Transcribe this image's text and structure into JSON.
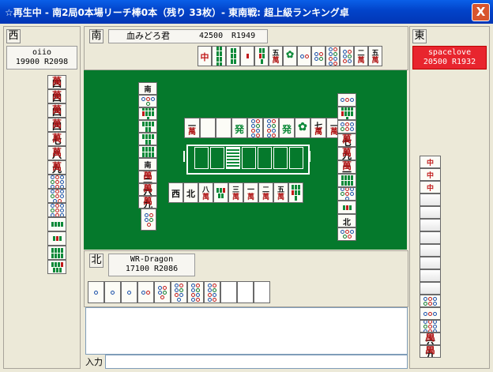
{
  "window": {
    "title": "☆再生中 - 南2局0本場リーチ棒0本（残り 33枚）- 東南戦: 超上級ランキング卓",
    "close": "X"
  },
  "players": {
    "south": {
      "seat": "南",
      "name": "血みどろ君",
      "score": "42500",
      "rating": "R1949"
    },
    "west": {
      "seat": "西",
      "name": "oiio",
      "score": "19900",
      "rating": "R2098"
    },
    "east": {
      "seat": "東",
      "name": "spacelove",
      "score": "20500",
      "rating": "R1932",
      "highlight": "#E8252E"
    },
    "north": {
      "seat": "北",
      "name": "WR-Dragon",
      "score": "17100",
      "rating": "R2086"
    }
  },
  "input": {
    "label": "入力",
    "value": ""
  },
  "colors": {
    "felt": "#05792C",
    "tile": "#FCFCF6",
    "man": "#B01818",
    "sou": "#0E8A3A",
    "pin": "#1A4FA8"
  },
  "hands": {
    "south_top": [
      "中",
      "8s",
      "6s",
      "1s",
      "5s",
      "5m",
      "1s-bird",
      "2p",
      "4p",
      "8p",
      "6p",
      "2m",
      "5m"
    ],
    "west_left": [
      "4m",
      "4m",
      "4m",
      "4m",
      "7m",
      "8m",
      "9m",
      "9p",
      "8p",
      "9p",
      "4s",
      "3s",
      "8s",
      "7s"
    ],
    "east_right": [
      "中",
      "中",
      "中",
      "back",
      "back",
      "back",
      "back",
      "back",
      "back",
      "back",
      "back",
      "6p",
      "3p",
      "9p",
      "6m",
      "9m"
    ],
    "north_bottom": [
      "1p",
      "1p",
      "1p",
      "2p",
      "5p",
      "7p",
      "8p",
      "8p",
      "blank",
      "blank",
      "blank"
    ]
  },
  "discards": {
    "south": [
      "1m",
      "白",
      "白",
      "発",
      "8p",
      "8p",
      "発",
      "1s-bird",
      "7m",
      "1m"
    ],
    "west": [
      "南",
      "4p",
      "9s",
      "6s",
      "6s",
      "8s",
      "南",
      "3m",
      "6m",
      "9m"
    ],
    "east": [
      "3p",
      "9s",
      "6p",
      "7m",
      "9m",
      "2m",
      "8s",
      "7p",
      "3s",
      "北",
      "5p"
    ],
    "north": [
      "西",
      "北",
      "8m",
      "5s",
      "3m",
      "1m",
      "2m",
      "5m",
      "7s"
    ]
  },
  "wall_center": {
    "dead_tiles": 7
  }
}
